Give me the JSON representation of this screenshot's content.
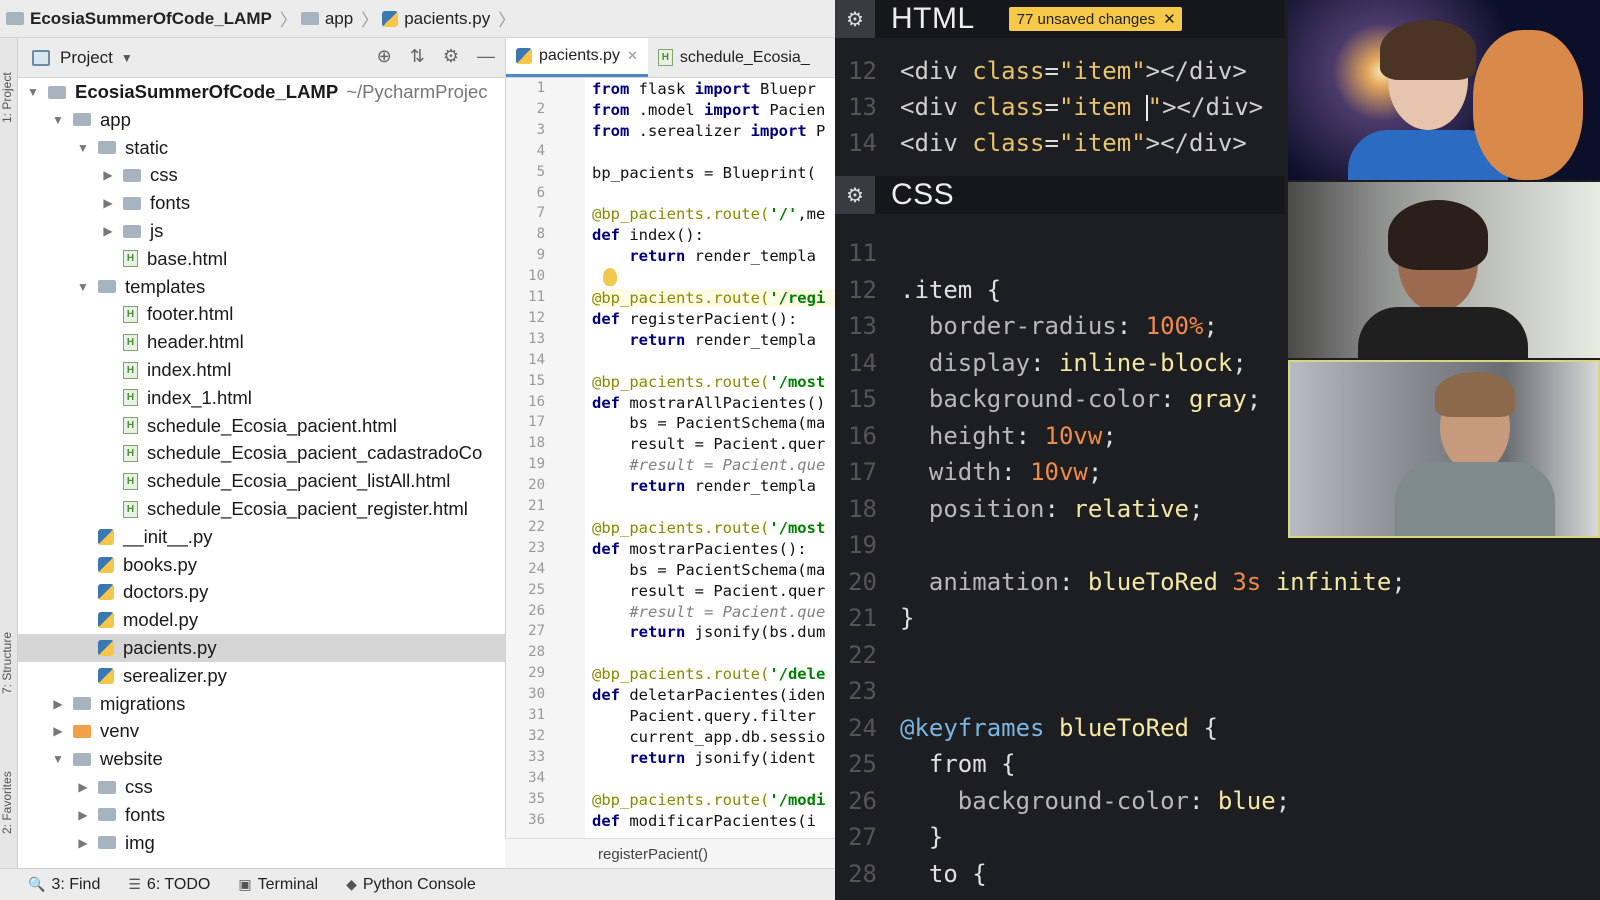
{
  "breadcrumb": {
    "project": "EcosiaSummerOfCode_LAMP",
    "folder": "app",
    "file": "pacients.py"
  },
  "sidebar_labels": {
    "project": "1: Project",
    "structure": "7: Structure",
    "favorites": "2: Favorites"
  },
  "project_panel": {
    "title": "Project",
    "tree": [
      {
        "label": "EcosiaSummerOfCode_LAMP",
        "hint": "~/PycharmProjec",
        "type": "folder",
        "depth": 0,
        "arrow": "▼",
        "bold": true
      },
      {
        "label": "app",
        "type": "folder",
        "depth": 1,
        "arrow": "▼"
      },
      {
        "label": "static",
        "type": "folder",
        "depth": 2,
        "arrow": "▼"
      },
      {
        "label": "css",
        "type": "folder",
        "depth": 3,
        "arrow": "▶"
      },
      {
        "label": "fonts",
        "type": "folder",
        "depth": 3,
        "arrow": "▶"
      },
      {
        "label": "js",
        "type": "folder",
        "depth": 3,
        "arrow": "▶"
      },
      {
        "label": "base.html",
        "type": "html",
        "depth": 3,
        "arrow": ""
      },
      {
        "label": "templates",
        "type": "folder",
        "depth": 2,
        "arrow": "▼"
      },
      {
        "label": "footer.html",
        "type": "html",
        "depth": 3,
        "arrow": ""
      },
      {
        "label": "header.html",
        "type": "html",
        "depth": 3,
        "arrow": ""
      },
      {
        "label": "index.html",
        "type": "html",
        "depth": 3,
        "arrow": ""
      },
      {
        "label": "index_1.html",
        "type": "html",
        "depth": 3,
        "arrow": ""
      },
      {
        "label": "schedule_Ecosia_pacient.html",
        "type": "html",
        "depth": 3,
        "arrow": ""
      },
      {
        "label": "schedule_Ecosia_pacient_cadastradoCo",
        "type": "html",
        "depth": 3,
        "arrow": ""
      },
      {
        "label": "schedule_Ecosia_pacient_listAll.html",
        "type": "html",
        "depth": 3,
        "arrow": ""
      },
      {
        "label": "schedule_Ecosia_pacient_register.html",
        "type": "html",
        "depth": 3,
        "arrow": ""
      },
      {
        "label": "__init__.py",
        "type": "py",
        "depth": 2,
        "arrow": ""
      },
      {
        "label": "books.py",
        "type": "py",
        "depth": 2,
        "arrow": ""
      },
      {
        "label": "doctors.py",
        "type": "py",
        "depth": 2,
        "arrow": ""
      },
      {
        "label": "model.py",
        "type": "py",
        "depth": 2,
        "arrow": ""
      },
      {
        "label": "pacients.py",
        "type": "py",
        "depth": 2,
        "arrow": "",
        "selected": true
      },
      {
        "label": "serealizer.py",
        "type": "py",
        "depth": 2,
        "arrow": ""
      },
      {
        "label": "migrations",
        "type": "folder",
        "depth": 1,
        "arrow": "▶"
      },
      {
        "label": "venv",
        "type": "folder-orange",
        "depth": 1,
        "arrow": "▶"
      },
      {
        "label": "website",
        "type": "folder",
        "depth": 1,
        "arrow": "▼"
      },
      {
        "label": "css",
        "type": "folder",
        "depth": 2,
        "arrow": "▶"
      },
      {
        "label": "fonts",
        "type": "folder",
        "depth": 2,
        "arrow": "▶"
      },
      {
        "label": "img",
        "type": "folder",
        "depth": 2,
        "arrow": "▶"
      }
    ]
  },
  "editor": {
    "tabs": [
      {
        "label": "pacients.py",
        "active": true
      },
      {
        "label": "schedule_Ecosia_",
        "active": false
      }
    ],
    "lines": [
      "<span class='kw'>from</span> flask <span class='kw'>import</span> Bluepr",
      "<span class='kw'>from</span> .model <span class='kw'>import</span> Pacien",
      "<span class='kw'>from</span> .serealizer <span class='kw'>import</span> P",
      "",
      "bp_pacients = Blueprint(",
      "",
      "<span class='dec'>@bp_pacients.route(</span><span class='str'>'/'</span>,me",
      "<span class='kw'>def</span> index():",
      "    <span class='kw'>return</span> render_templa",
      "",
      "<span class='dec'>@bp_pacients.route(</span><span class='str'>'/regi</span>",
      "<span class='kw'>def</span> registerPacient():",
      "    <span class='kw'>return</span> render_templa",
      "",
      "<span class='dec'>@bp_pacients.route(</span><span class='str'>'/most</span>",
      "<span class='kw'>def</span> mostrarAllPacientes()",
      "    bs = PacientSchema(ma",
      "    result = Pacient.quer",
      "    <span class='cm'>#result = Pacient.que</span>",
      "    <span class='kw'>return</span> render_templa",
      "",
      "<span class='dec'>@bp_pacients.route(</span><span class='str'>'/most</span>",
      "<span class='kw'>def</span> mostrarPacientes():",
      "    bs = PacientSchema(ma",
      "    result = Pacient.quer",
      "    <span class='cm'>#result = Pacient.que</span>",
      "    <span class='kw'>return</span> jsonify(bs.dum",
      "",
      "<span class='dec'>@bp_pacients.route(</span><span class='str'>'/dele</span>",
      "<span class='kw'>def</span> deletarPacientes(iden",
      "    Pacient.query.filter",
      "    current_app.db.sessio",
      "    <span class='kw'>return</span> jsonify(ident",
      "",
      "<span class='dec'>@bp_pacients.route(</span><span class='str'>'/modi</span>",
      "<span class='kw'>def</span> modificarPacientes(i"
    ],
    "current_line": 11,
    "function_breadcrumb": "registerPacient()"
  },
  "statusbar": [
    {
      "label": "3: Find",
      "icon": "search-icon"
    },
    {
      "label": "6: TODO",
      "icon": "list-icon"
    },
    {
      "label": "Terminal",
      "icon": "terminal-icon"
    },
    {
      "label": "Python Console",
      "icon": "python-icon"
    }
  ],
  "html_panel": {
    "title": "HTML",
    "badge": "77 unsaved changes",
    "lines": [
      {
        "n": "12",
        "code": "<span class='tag'>&lt;div</span> <span class='attr'>class</span>=<span class='aval'>\"item\"</span><span class='tag'>&gt;&lt;/div&gt;</span>"
      },
      {
        "n": "13",
        "code": "<span class='tag'>&lt;div</span> <span class='attr'>class</span>=<span class='aval'>\"item </span><span class='cursor'></span><span class='aval'>\"</span><span class='tag'>&gt;&lt;/div&gt;</span>"
      },
      {
        "n": "14",
        "code": "<span class='tag'>&lt;div</span> <span class='attr'>class</span>=<span class='aval'>\"item\"</span><span class='tag'>&gt;&lt;/div&gt;</span>"
      }
    ]
  },
  "css_panel": {
    "title": "CSS",
    "lines": [
      {
        "n": "11",
        "code": ""
      },
      {
        "n": "12",
        "code": "<span class='sel'>.item {</span>"
      },
      {
        "n": "13",
        "code": "  <span class='prop'>border-radius</span>: <span class='num'>100%</span>;"
      },
      {
        "n": "14",
        "code": "  <span class='prop'>display</span>: <span class='val'>inline-block</span>;"
      },
      {
        "n": "15",
        "code": "  <span class='prop'>background-color</span>: <span class='val'>gray</span>;"
      },
      {
        "n": "16",
        "code": "  <span class='prop'>height</span>: <span class='num'>10vw</span>;"
      },
      {
        "n": "17",
        "code": "  <span class='prop'>width</span>: <span class='num'>10vw</span>;"
      },
      {
        "n": "18",
        "code": "  <span class='prop'>position</span>: <span class='val'>relative</span>;"
      },
      {
        "n": "19",
        "code": ""
      },
      {
        "n": "20",
        "code": "  <span class='prop'>animation</span>: <span class='val'>blueToRed</span> <span class='num'>3s</span> <span class='val'>infinite</span>;"
      },
      {
        "n": "21",
        "code": "<span class='sel'>}</span>"
      },
      {
        "n": "22",
        "code": ""
      },
      {
        "n": "23",
        "code": ""
      },
      {
        "n": "24",
        "code": "<span class='atrule'>@keyframes</span> <span class='val'>blueToRed</span> <span class='sel'>{</span>"
      },
      {
        "n": "25",
        "code": "  <span class='sel'>from {</span>"
      },
      {
        "n": "26",
        "code": "    <span class='prop'>background-color</span>: <span class='val'>blue</span>;"
      },
      {
        "n": "27",
        "code": "  <span class='sel'>}</span>"
      },
      {
        "n": "28",
        "code": "  <span class='sel'>to {</span>"
      }
    ]
  }
}
